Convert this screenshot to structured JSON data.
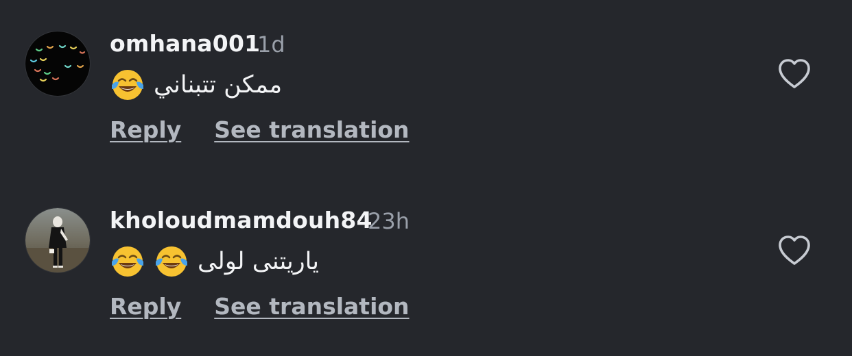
{
  "comments": [
    {
      "avatar_icon": "dark-pattern-avatar",
      "username": "omhana001",
      "time": "1d",
      "text": "ممكن تتبناني",
      "emoji_icons": [
        "face-with-tears-of-joy-icon"
      ],
      "reply_label": "Reply",
      "translate_label": "See translation",
      "like_icon": "heart-outline-icon"
    },
    {
      "avatar_icon": "person-photo-avatar",
      "username": "kholoudmamdouh84",
      "time": "23h",
      "text": "ياريتنى لولى",
      "emoji_icons": [
        "face-with-tears-of-joy-icon",
        "face-with-tears-of-joy-icon"
      ],
      "reply_label": "Reply",
      "translate_label": "See translation",
      "like_icon": "heart-outline-icon"
    }
  ],
  "colors": {
    "background": "#25272c",
    "text_primary": "#f3f4f6",
    "text_secondary": "#9aa0aa",
    "link": "#b3b8c0",
    "emoji_yellow": "#f7c231"
  }
}
